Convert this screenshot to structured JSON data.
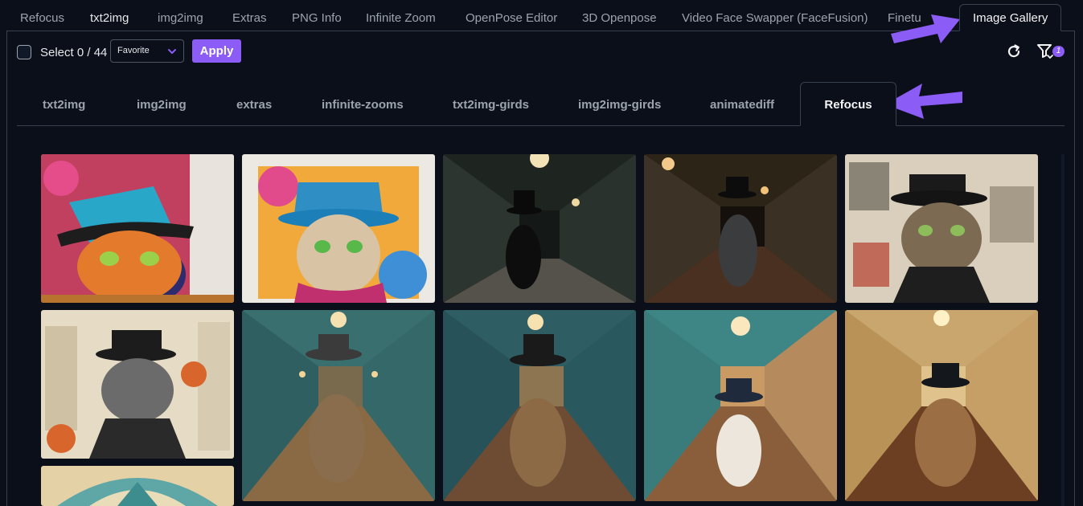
{
  "top_tabs": [
    {
      "label": "Refocus"
    },
    {
      "label": "txt2img"
    },
    {
      "label": "img2img"
    },
    {
      "label": "Extras"
    },
    {
      "label": "PNG Info"
    },
    {
      "label": "Infinite Zoom"
    },
    {
      "label": "OpenPose Editor"
    },
    {
      "label": "3D Openpose"
    },
    {
      "label": "Video Face Swapper (FaceFusion)"
    },
    {
      "label": "Finetu"
    },
    {
      "label": "Image Gallery"
    }
  ],
  "toolbar": {
    "select_label": "Select 0 / 44",
    "dropdown_value": "Favorite",
    "apply_label": "Apply",
    "filter_badge": "1"
  },
  "sub_tabs": [
    {
      "label": "txt2img"
    },
    {
      "label": "img2img"
    },
    {
      "label": "extras"
    },
    {
      "label": "infinite-zooms"
    },
    {
      "label": "txt2img-girds"
    },
    {
      "label": "img2img-girds"
    },
    {
      "label": "animatediff"
    },
    {
      "label": "Refocus"
    }
  ],
  "colors": {
    "background": "#0b0f19",
    "accent": "#8b5cf6",
    "border": "#374151",
    "annotation_arrow": "#8b5cf6"
  },
  "icons": {
    "checkbox": "checkbox-icon",
    "dropdown": "chevron-down-icon",
    "refresh": "refresh-icon",
    "filter": "filter-icon",
    "arrow": "annotation-arrow-icon"
  }
}
